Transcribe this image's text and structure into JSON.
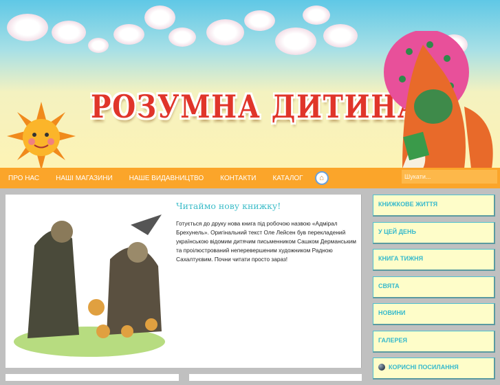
{
  "header": {
    "logo_text": "РОЗУМНА ДИТИНА"
  },
  "nav": {
    "items": [
      "ПРО НАС",
      "НАШІ МАГАЗИНИ",
      "НАШЕ ВИДАВНИЦТВО",
      "КОНТАКТИ",
      "КАТАЛОГ"
    ],
    "home_icon": "home-icon",
    "search_placeholder": "Шукати..."
  },
  "article": {
    "title": "Читаймо нову книжку!",
    "body": "Готується до друку нова книга під робочою назвою «Адмірал Брехунель». Оригінальний текст Оле Лейсен був перекладений українською відомим дитячим письменником Сашком Дерманським та проілюстрований неперевершеним художником Радною Сахалтуєвим. Почни читати просто зараз!"
  },
  "sidebar": {
    "items": [
      "КНИЖКОВЕ ЖИТТЯ",
      "У ЦЕЙ ДЕНЬ",
      "КНИГА ТИЖНЯ",
      "СВЯТА",
      "НОВИНИ",
      "ГАЛЕРЕЯ",
      "КОРИСНІ ПОСИЛАННЯ"
    ]
  }
}
